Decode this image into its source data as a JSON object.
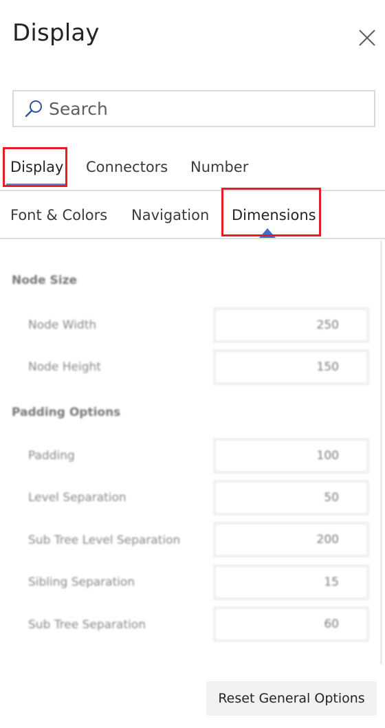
{
  "header": {
    "title": "Display",
    "close_icon": "close-icon"
  },
  "search": {
    "placeholder": "Search",
    "value": "",
    "icon": "search-icon"
  },
  "primary_tabs": [
    {
      "label": "Display",
      "active": true
    },
    {
      "label": "Connectors",
      "active": false
    },
    {
      "label": "Number",
      "active": false
    }
  ],
  "secondary_tabs": [
    {
      "label": "Font & Colors",
      "active": false
    },
    {
      "label": "Navigation",
      "active": false
    },
    {
      "label": "Dimensions",
      "active": true
    }
  ],
  "sections": {
    "node_size": {
      "title": "Node Size",
      "rows": [
        {
          "label": "Node Width",
          "value": "250"
        },
        {
          "label": "Node Height",
          "value": "150"
        }
      ]
    },
    "padding_options": {
      "title": "Padding Options",
      "rows": [
        {
          "label": "Padding",
          "value": "100"
        },
        {
          "label": "Level Separation",
          "value": "50"
        },
        {
          "label": "Sub Tree Level Separation",
          "value": "200"
        },
        {
          "label": "Sibling Separation",
          "value": "15"
        },
        {
          "label": "Sub Tree Separation",
          "value": "60"
        }
      ]
    }
  },
  "footer": {
    "reset_label": "Reset General Options"
  },
  "colors": {
    "active_tab_indicator": "#6b7ed6",
    "active_caret": "#3d6ed0",
    "highlight_box": "#e41e26"
  }
}
